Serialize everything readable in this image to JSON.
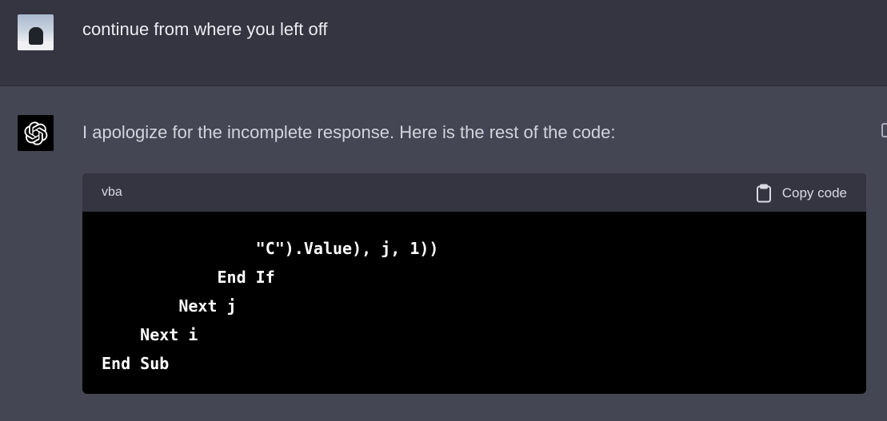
{
  "user_message": {
    "text": "continue from where you left off"
  },
  "assistant_message": {
    "text": "I apologize for the incomplete response. Here is the rest of the code:",
    "code_block": {
      "language": "vba",
      "copy_label": "Copy code",
      "lines": [
        "                \"C\").Value), j, 1))",
        "            End If",
        "        Next j",
        "    Next i",
        "End Sub"
      ]
    }
  },
  "icons": {
    "user_avatar": "user-avatar-photo",
    "assistant_avatar": "openai-logo-icon",
    "copy": "clipboard-icon"
  },
  "colors": {
    "user_bg": "#343541",
    "assistant_bg": "#444654",
    "code_bg": "#000000",
    "code_header_bg": "#343541"
  }
}
